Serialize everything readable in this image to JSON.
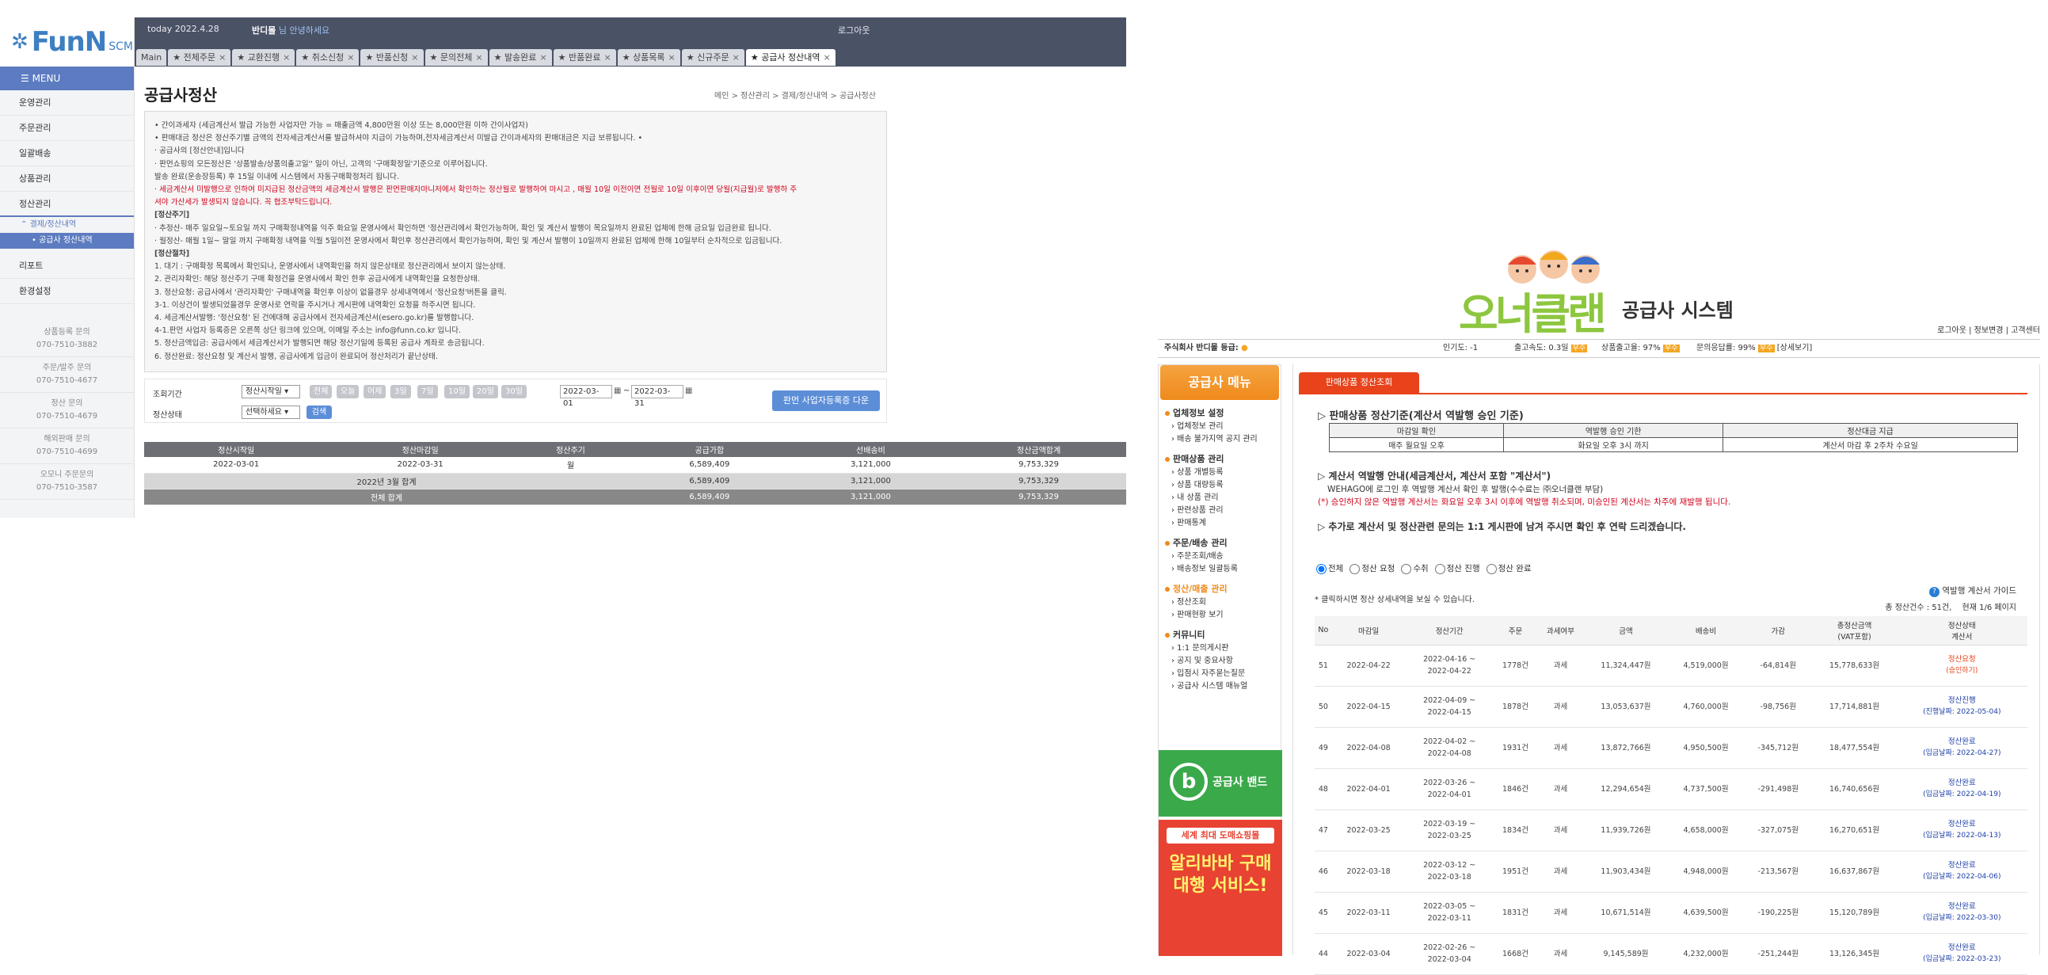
{
  "left_app": {
    "logo": {
      "brand": "FunN",
      "suffix": "SCM"
    },
    "topbar": {
      "date_label": "today",
      "date": "2022.4.28",
      "user": "반디몰",
      "greeting": "님 안녕하세요",
      "logout": "로그아웃"
    },
    "tabs": [
      {
        "label": "Main",
        "closable": false
      },
      {
        "label": "전체주문",
        "closable": true
      },
      {
        "label": "교환진행",
        "closable": true
      },
      {
        "label": "취소신청",
        "closable": true
      },
      {
        "label": "반품신청",
        "closable": true
      },
      {
        "label": "문의전체",
        "closable": true
      },
      {
        "label": "발송완료",
        "closable": true
      },
      {
        "label": "반품완료",
        "closable": true
      },
      {
        "label": "상품목록",
        "closable": true
      },
      {
        "label": "신규주문",
        "closable": true
      },
      {
        "label": "공급사 정산내역",
        "closable": true,
        "active": true
      }
    ],
    "sidebar": {
      "menu_label": "MENU",
      "items": [
        "운영관리",
        "주문관리",
        "일괄배송",
        "상품관리",
        "정산관리"
      ],
      "sub_group": "결제/정산내역",
      "sub_active": "공급사 정산내역",
      "items_after": [
        "리포트",
        "환경설정"
      ],
      "contacts": [
        {
          "label": "상품등록 문의",
          "phone": "070-7510-3882"
        },
        {
          "label": "주문/발주 문의",
          "phone": "070-7510-4677"
        },
        {
          "label": "정산 문의",
          "phone": "070-7510-4679"
        },
        {
          "label": "해외판매 문의",
          "phone": "070-7510-4699"
        },
        {
          "label": "오모니 주문문의",
          "phone": "070-7510-3587"
        }
      ]
    },
    "page": {
      "title": "공급사정산",
      "breadcrumb": "메인 > 정산관리 > 결제/정산내역 > 공급사정산"
    },
    "notice_lines": [
      {
        "t": "• 간이과세자 (세금계산서 발급 가능한 사업자만 가능 = 매출금액 4,800만원 이상 또는 8,000만원 이하 간이사업자)",
        "c": ""
      },
      {
        "t": "• 판매대금 정산은 정산주기별 금액의 전자세금계산서를 발급하셔야 지급이 가능하며,전자세금계산서 미발급 간이과세자의 판매대금은 지급 보류됩니다. •",
        "c": ""
      },
      {
        "t": "· 공급사의 [정산안내]입니다",
        "c": ""
      },
      {
        "t": "· 판먼쇼핑의 모든정산은 '상품발송/상품의출고일'' 일이 아닌, 고객의 '구매확정일'기준으로 이루어집니다.",
        "c": ""
      },
      {
        "t": "  발송 완료(운송장등록) 후 15일 이내에 시스템에서 자동구매확정처리 됩니다.",
        "c": ""
      },
      {
        "t": "· 세금계산서 미발행으로 인하여 미지급된 정산금액의 세금계산서 발행은 판먼판매자마니저에서 확인하는 정산월로 발행하여 마시고 , 매월 10일 이전이면 전월로 10일 이후이면 당월(지급월)로 발행하 주",
        "c": "red"
      },
      {
        "t": "셔야 가산세가 발생되지 않습니다. 꼭 협조부탁드립니다.",
        "c": "red"
      },
      {
        "t": "[정산주기]",
        "c": "b"
      },
      {
        "t": "· 추정산- 매주 일요일~토요일 까지 구매확정내역을 익주 화요일 운영사에서 확인하면 '정산관리에서 확인가능하며, 확인 및 계산서 발행이 목요일까지 완료된 업체에 한해 금요일 입금완료 됩니다.",
        "c": ""
      },
      {
        "t": "· 월정산- 매월 1일~ 말일 까지 구매확정 내역을 익월 5일이전 운영사에서 확인후 정산관리에서 확인가능하며, 확인 및 계산서 발행이 10일까지 완료된 업체에 한해 10일부터 순차적으로 입금됩니다.",
        "c": ""
      },
      {
        "t": "[정산절차]",
        "c": "b"
      },
      {
        "t": "1. 대기 : 구매확정 목록에서 확인되나, 운영사에서 내역확인을 하지 않은상태로 정산관리에서 보이지 않는상태.",
        "c": ""
      },
      {
        "t": "2. 관리자확인: 해당 정산주기 구매 확정건을 운영사에서 확인 한후 공급사에게 내역확인을 요청한상태.",
        "c": ""
      },
      {
        "t": "3. 정산요청: 공급사에서 '관리자확인' 구매내역을 확인후 이상이 없을경우 상세내역에서 '정산요청'버튼을 클릭.",
        "c": ""
      },
      {
        "t": "3-1. 이상건이 발생되었을경우 운영사로 연락을 주시거나 게시판에 내역확인 요청을 하주시면 됩니다.",
        "c": ""
      },
      {
        "t": "4. 세금계산서발행: '정산요청' 된 건에대해 공급사에서 전자세금계산서(esero.go.kr)를 발행합니다.",
        "c": ""
      },
      {
        "t": "4-1.판먼 사업자 등록증은 오른쪽 상단 링크에 있으며, 이메일 주소는 info@funn.co.kr 입니다.",
        "c": ""
      },
      {
        "t": "5. 정산금액입금: 공급사에서 세금계산서가 발행되면 해당 정산기일에 등록된 공급사 계좌로 송금됩니다.",
        "c": ""
      },
      {
        "t": "6. 정산완료: 정산요청 및 계산서 발행, 공급사에게 입금이 완료되어 정산처리가 끝난상태.",
        "c": ""
      }
    ],
    "filter": {
      "period_label": "조회기간",
      "period_select": "정산시작일",
      "quick": [
        "전체",
        "오늘",
        "어제",
        "3일",
        "7일",
        "10일",
        "20일",
        "30일"
      ],
      "date_from": "2022-03-01",
      "tilde": "~",
      "date_to": "2022-03-31",
      "status_label": "정산상태",
      "status_select": "선택하세요",
      "search_btn": "검색",
      "biz_btn": "판먼 사업자등록증 다운"
    },
    "table": {
      "headers": [
        "정산시작일",
        "정산마감일",
        "정산주기",
        "공급가합",
        "선배송비",
        "정산금액합계"
      ],
      "rows": [
        [
          "2022-03-01",
          "2022-03-31",
          "월",
          "6,589,409",
          "3,121,000",
          "9,753,329"
        ]
      ],
      "month_total": {
        "label": "2022년 3월 합계",
        "supply": "6,589,409",
        "ship": "3,121,000",
        "total": "9,753,329"
      },
      "grand_total": {
        "label": "전체 합계",
        "supply": "6,589,409",
        "ship": "3,121,000",
        "total": "9,753,329"
      }
    }
  },
  "right_app": {
    "logo": {
      "brand": "오너클랜",
      "sub": "공급사 시스템"
    },
    "toplinks": "로그아웃 | 정보변경 | 고객센터",
    "status": {
      "company": "주식회사 반디몰 등급:",
      "popularity": "인기도: -1",
      "ship_speed": "출고속도: 0.3일",
      "ok": "우수",
      "stock": "상품출고율: 97%",
      "reply": "문의응답률: 99%",
      "detail": "[상세보기]"
    },
    "side": {
      "title": "공급사 메뉴",
      "sections": [
        {
          "title": "업체정보 설정",
          "links": [
            "업체정보 관리",
            "배송 불가지역 공지 관리"
          ]
        },
        {
          "title": "판매상품 관리",
          "links": [
            "상품 개별등록",
            "상품 대량등록",
            "내 상품 관리",
            "판련상품 관리",
            "판매통계"
          ]
        },
        {
          "title": "주문/배송 관리",
          "links": [
            "주문조회/배송",
            "배송정보 일괄등록"
          ]
        },
        {
          "title": "정산/매출 관리",
          "links": [
            "정산조회",
            "판매현황 보기"
          ],
          "active": true
        },
        {
          "title": "커뮤니티",
          "links": [
            "1:1 문의게시판",
            "공지 및 중요사항",
            "입점시 자주묻는질문",
            "공급사 시스템 매뉴얼"
          ]
        }
      ],
      "band_label": "공급사 밴드",
      "promo_top": "세계 최대 도매쇼핑몰",
      "promo_main": "알리바바 구매대행 서비스!"
    },
    "tab": "판매상품 정산조회",
    "criteria_title": "▷ 판매상품 정산기준(계산서 역발행 승인 기준)",
    "criteria": {
      "headers": [
        "마감일 확인",
        "역발행 승인 기한",
        "정산대금 지급"
      ],
      "values": [
        "매주 월요일 오후",
        "화요일 오후 3시 까지",
        "계산서 마감 후 2주차 수요일"
      ]
    },
    "reverse_title": "▷ 계산서 역발행 안내(세금계산서, 계산서 포함 \"계산서\")",
    "reverse_line1": "WEHAGO에 로그인 후 역발행 계산서 확인 후 발행(수수료는 ㈜오너클랜 부담)",
    "reverse_line2": "(*) 승인하지 않은 역발행 계산서는 화요일 오후 3시 이후에 역발행 취소되며, 미승인된 계산서는 차주에 재발행 됩니다.",
    "more_title": "▷ 추가로 계산서 및 정산관련 문의는 1:1 게시판에 남겨 주시면 확인 후 연락 드리겠습니다.",
    "radios": [
      "전체",
      "정산 요청",
      "수취",
      "정산 진행",
      "정산 완료"
    ],
    "guide": "역발행 계산서 가이드",
    "click_note": "* 클릭하시면 정산 상세내역을 보실 수 있습니다.",
    "count": "총 정산건수 : 51건,",
    "page": "현재 1/6 페이지",
    "headers": [
      "No",
      "마감일",
      "정산기간",
      "주문",
      "과세여부",
      "금액",
      "배송비",
      "가감",
      "총정산금액\n(VAT포함)",
      "정산상태\n계산서"
    ],
    "rows": [
      {
        "no": "51",
        "close": "2022-04-22",
        "p1": "2022-04-16 ~",
        "p2": "2022-04-22",
        "orders": "1778건",
        "tax": "과세",
        "amount": "11,324,447원",
        "ship": "4,519,000원",
        "adj": "-64,814원",
        "total": "15,778,633원",
        "s1": "정산요청",
        "s2": "(승인하기)",
        "cls": "st1"
      },
      {
        "no": "50",
        "close": "2022-04-15",
        "p1": "2022-04-09 ~",
        "p2": "2022-04-15",
        "orders": "1878건",
        "tax": "과세",
        "amount": "13,053,637원",
        "ship": "4,760,000원",
        "adj": "-98,756원",
        "total": "17,714,881원",
        "s1": "정산진행",
        "s2": "(진행날짜: 2022-05-04)",
        "cls": "st2"
      },
      {
        "no": "49",
        "close": "2022-04-08",
        "p1": "2022-04-02 ~",
        "p2": "2022-04-08",
        "orders": "1931건",
        "tax": "과세",
        "amount": "13,872,766원",
        "ship": "4,950,500원",
        "adj": "-345,712원",
        "total": "18,477,554원",
        "s1": "정산완료",
        "s2": "(입금날짜: 2022-04-27)",
        "cls": "st2"
      },
      {
        "no": "48",
        "close": "2022-04-01",
        "p1": "2022-03-26 ~",
        "p2": "2022-04-01",
        "orders": "1846건",
        "tax": "과세",
        "amount": "12,294,654원",
        "ship": "4,737,500원",
        "adj": "-291,498원",
        "total": "16,740,656원",
        "s1": "정산완료",
        "s2": "(입금날짜: 2022-04-19)",
        "cls": "st2"
      },
      {
        "no": "47",
        "close": "2022-03-25",
        "p1": "2022-03-19 ~",
        "p2": "2022-03-25",
        "orders": "1834건",
        "tax": "과세",
        "amount": "11,939,726원",
        "ship": "4,658,000원",
        "adj": "-327,075원",
        "total": "16,270,651원",
        "s1": "정산완료",
        "s2": "(입금날짜: 2022-04-13)",
        "cls": "st2"
      },
      {
        "no": "46",
        "close": "2022-03-18",
        "p1": "2022-03-12 ~",
        "p2": "2022-03-18",
        "orders": "1951건",
        "tax": "과세",
        "amount": "11,903,434원",
        "ship": "4,948,000원",
        "adj": "-213,567원",
        "total": "16,637,867원",
        "s1": "정산완료",
        "s2": "(입금날짜: 2022-04-06)",
        "cls": "st2"
      },
      {
        "no": "45",
        "close": "2022-03-11",
        "p1": "2022-03-05 ~",
        "p2": "2022-03-11",
        "orders": "1831건",
        "tax": "과세",
        "amount": "10,671,514원",
        "ship": "4,639,500원",
        "adj": "-190,225원",
        "total": "15,120,789원",
        "s1": "정산완료",
        "s2": "(입금날짜: 2022-03-30)",
        "cls": "st2"
      },
      {
        "no": "44",
        "close": "2022-03-04",
        "p1": "2022-02-26 ~",
        "p2": "2022-03-04",
        "orders": "1668건",
        "tax": "과세",
        "amount": "9,145,589원",
        "ship": "4,232,000원",
        "adj": "-251,244원",
        "total": "13,126,345원",
        "s1": "정산완료",
        "s2": "(입금날짜: 2022-03-23)",
        "cls": "st2"
      }
    ]
  }
}
